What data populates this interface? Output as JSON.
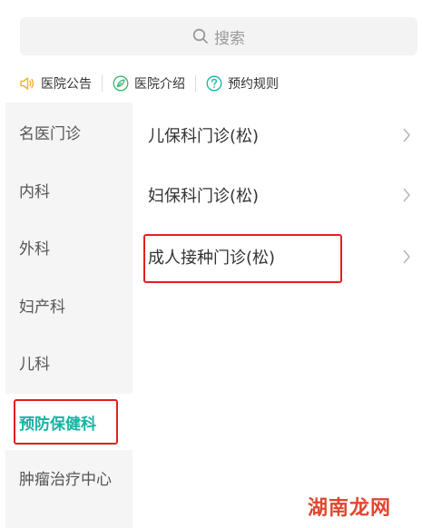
{
  "search": {
    "placeholder": "搜索"
  },
  "notices": [
    {
      "label": "医院公告",
      "icon": "speaker-icon",
      "color": "#f2b632"
    },
    {
      "label": "医院介绍",
      "icon": "leaf-icon",
      "color": "#3cb371"
    },
    {
      "label": "预约规则",
      "icon": "question-icon",
      "color": "#17b3a3"
    }
  ],
  "sidebar": {
    "items": [
      {
        "label": "名医门诊"
      },
      {
        "label": "内科"
      },
      {
        "label": "外科"
      },
      {
        "label": "妇产科"
      },
      {
        "label": "儿科"
      },
      {
        "label": "预防保健科",
        "active": true
      },
      {
        "label": "肿瘤治疗中心"
      }
    ]
  },
  "departments": [
    {
      "label": "儿保科门诊(松)"
    },
    {
      "label": "妇保科门诊(松)"
    },
    {
      "label": "成人接种门诊(松)"
    }
  ],
  "colors": {
    "accent": "#17b3a3",
    "highlight": "#e02020"
  },
  "watermark": "湖南龙网"
}
